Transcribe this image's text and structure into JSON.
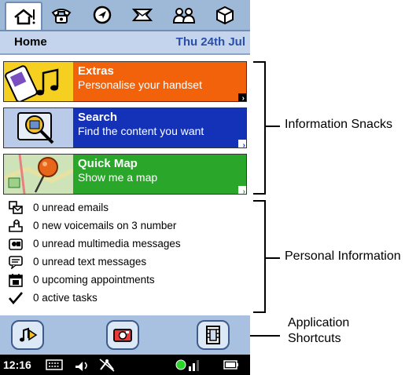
{
  "tabs": [
    {
      "icon": "home-icon",
      "active": true
    },
    {
      "icon": "phone-icon",
      "active": false
    },
    {
      "icon": "compass-icon",
      "active": false
    },
    {
      "icon": "messages-icon",
      "active": false
    },
    {
      "icon": "contacts-icon",
      "active": false
    },
    {
      "icon": "package-icon",
      "active": false
    }
  ],
  "header": {
    "title": "Home",
    "date": "Thu 24th Jul"
  },
  "snacks": [
    {
      "title": "Extras",
      "subtitle": "Personalise your handset",
      "color": "#f2620a"
    },
    {
      "title": "Search",
      "subtitle": "Find the content you want",
      "color": "#1432b8"
    },
    {
      "title": "Quick Map",
      "subtitle": "Show me a map",
      "color": "#2aa62a"
    }
  ],
  "personal": [
    {
      "icon": "email-icon",
      "text": "0 unread emails"
    },
    {
      "icon": "voicemail-icon",
      "text": "0 new voicemails on 3 number"
    },
    {
      "icon": "multimedia-message-icon",
      "text": "0 unread multimedia messages"
    },
    {
      "icon": "text-message-icon",
      "text": "0 unread text messages"
    },
    {
      "icon": "calendar-icon",
      "text": "0 upcoming appointments"
    },
    {
      "icon": "checkmark-icon",
      "text": "0 active tasks"
    }
  ],
  "shortcuts": [
    {
      "icon": "music-player-icon"
    },
    {
      "icon": "camera-icon"
    },
    {
      "icon": "video-player-icon"
    }
  ],
  "status": {
    "time": "12:16"
  },
  "annotations": {
    "snacks": "Information Snacks",
    "personal": "Personal Information",
    "shortcuts_line1": "Application",
    "shortcuts_line2": "Shortcuts"
  }
}
